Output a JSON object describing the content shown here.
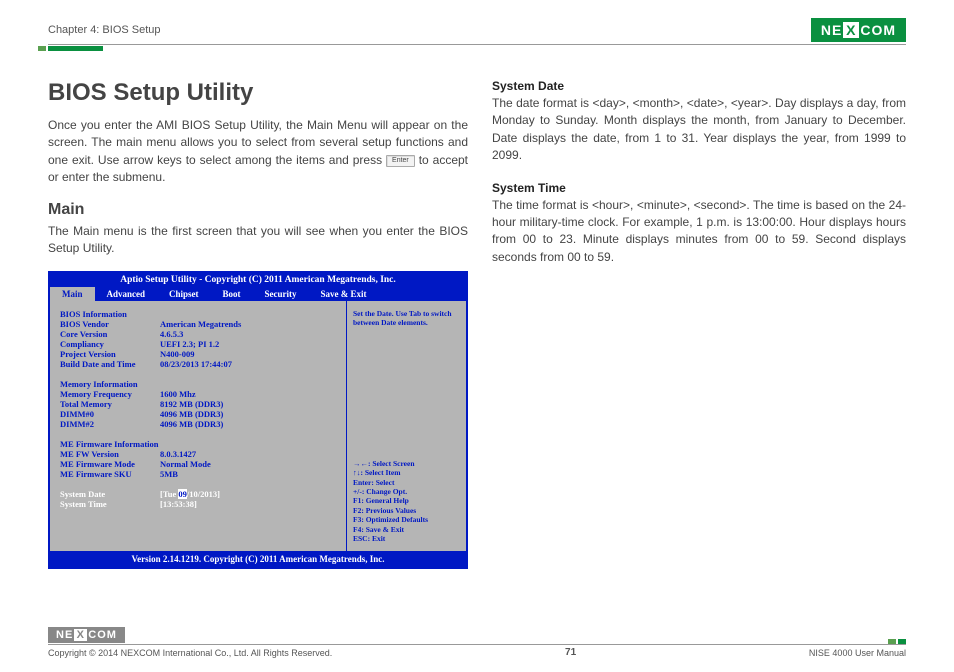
{
  "header": {
    "chapter": "Chapter 4: BIOS Setup",
    "brand": "NE",
    "brand_x": "X",
    "brand_end": "COM"
  },
  "title": "BIOS Setup Utility",
  "intro_p1a": "Once you enter the AMI BIOS Setup Utility, the Main Menu will appear on the screen. The main menu allows you to select from several setup functions and one exit. Use arrow keys to select among the items and press ",
  "intro_enter": "Enter",
  "intro_p1b": " to accept or enter the submenu.",
  "main_heading": "Main",
  "main_text": "The Main menu is the first screen that you will see when you enter the BIOS Setup Utility.",
  "right": {
    "sd_h": "System Date",
    "sd_t": "The date format is <day>, <month>, <date>, <year>. Day displays a day, from Monday to Sunday. Month displays the month, from January to December. Date displays the date, from 1 to 31. Year displays the year, from 1999 to 2099.",
    "st_h": "System Time",
    "st_t": "The time format is <hour>, <minute>, <second>. The time is based on the 24-hour military-time clock. For example, 1 p.m. is 13:00:00. Hour displays hours from 00 to 23. Minute displays minutes from 00 to 59. Second displays seconds from 00 to 59."
  },
  "bios": {
    "bar_title": "Aptio Setup Utility - Copyright (C) 2011 American Megatrends, Inc.",
    "tabs": [
      "Main",
      "Advanced",
      "Chipset",
      "Boot",
      "Security",
      "Save & Exit"
    ],
    "info_h": "BIOS Information",
    "rows1": [
      {
        "l": "BIOS Vendor",
        "v": "American Megatrends"
      },
      {
        "l": "Core Version",
        "v": "4.6.5.3"
      },
      {
        "l": "Compliancy",
        "v": "UEFI 2.3; PI 1.2"
      },
      {
        "l": "Project Version",
        "v": "N400-009"
      },
      {
        "l": "Build Date and Time",
        "v": "08/23/2013 17:44:07"
      }
    ],
    "mem_h": "Memory Information",
    "rows2": [
      {
        "l": "Memory Frequency",
        "v": "1600 Mhz"
      },
      {
        "l": "Total Memory",
        "v": "8192 MB (DDR3)"
      },
      {
        "l": "DIMM#0",
        "v": "4096 MB (DDR3)"
      },
      {
        "l": "DIMM#2",
        "v": "4096 MB (DDR3)"
      }
    ],
    "me_h": "ME Firmware Information",
    "rows3": [
      {
        "l": "ME FW Version",
        "v": "8.0.3.1427"
      },
      {
        "l": "ME Firmware Mode",
        "v": "Normal Mode"
      },
      {
        "l": "ME Firmware SKU",
        "v": "5MB"
      }
    ],
    "sysdate_l": "System Date",
    "sysdate_v_pre": "[Tue ",
    "sysdate_v_hl": "09",
    "sysdate_v_post": "/10/2013]",
    "systime_l": "System Time",
    "systime_v": "[13:53:38]",
    "help_top": "Set the Date. Use Tab to switch between Date elements.",
    "help_bottom": [
      "→←: Select Screen",
      "↑↓: Select Item",
      "Enter: Select",
      "+/-: Change Opt.",
      "F1: General Help",
      "F2: Previous Values",
      "F3: Optimized Defaults",
      "F4: Save & Exit",
      "ESC: Exit"
    ],
    "footer": "Version 2.14.1219. Copyright (C) 2011 American Megatrends, Inc."
  },
  "footer": {
    "copyright": "Copyright © 2014 NEXCOM International Co., Ltd. All Rights Reserved.",
    "page": "71",
    "doc": "NISE 4000 User Manual"
  }
}
